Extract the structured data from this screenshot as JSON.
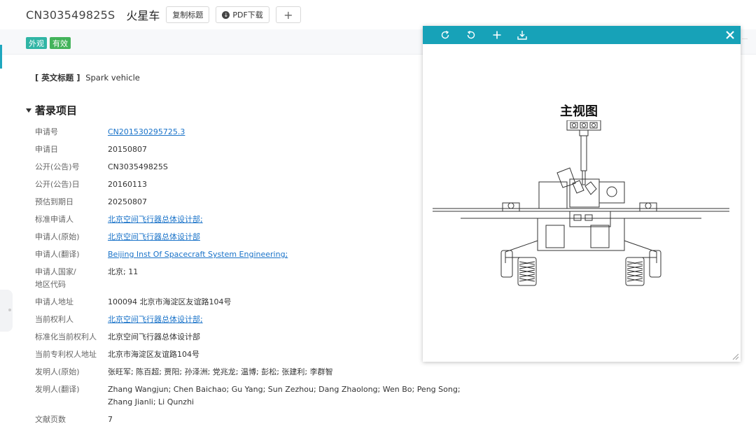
{
  "header": {
    "pub_no": "CN303549825S",
    "title_cn": "火星车",
    "copy_title_label": "复制标题",
    "pdf_label": "PDF下载",
    "plus_label": "+"
  },
  "tags": [
    "外观",
    "有效"
  ],
  "en_title": {
    "label": "[ 英文标题 ]",
    "value": "Spark vehicle"
  },
  "section_title": "著录项目",
  "fields": [
    {
      "k": "申请号",
      "v": "CN201530295725.3",
      "link": true
    },
    {
      "k": "申请日",
      "v": "20150807"
    },
    {
      "k": "公开(公告)号",
      "v": "CN303549825S"
    },
    {
      "k": "公开(公告)日",
      "v": "20160113"
    },
    {
      "k": "预估到期日",
      "v": "20250807"
    },
    {
      "k": "标准申请人",
      "v": "北京空间飞行器总体设计部;",
      "link": true
    },
    {
      "k": "申请人(原始)",
      "v": "北京空间飞行器总体设计部",
      "link": true
    },
    {
      "k": "申请人(翻译)",
      "v": "Beijing Inst Of Spacecraft System Engineering;",
      "link": true
    },
    {
      "k": "申请人国家/\n地区代码",
      "v": "北京; 11"
    },
    {
      "k": "申请人地址",
      "v": "100094 北京市海淀区友谊路104号"
    },
    {
      "k": "当前权利人",
      "v": "北京空间飞行器总体设计部;",
      "link": true
    },
    {
      "k": "标准化当前权利人",
      "v": "北京空间飞行器总体设计部"
    },
    {
      "k": "当前专利权人地址",
      "v": "北京市海淀区友谊路104号"
    },
    {
      "k": "发明人(原始)",
      "v": "张旺军; 陈百超; 贾阳; 孙泽洲; 党兆龙; 温博; 彭松; 张建利; 李群智"
    },
    {
      "k": "发明人(翻译)",
      "v": "Zhang Wangjun; Chen Baichao; Gu Yang; Sun Zezhou; Dang Zhaolong; Wen Bo; Peng Song; Zhang Jianli; Li Qunzhi"
    },
    {
      "k": "文献页数",
      "v": "7"
    }
  ],
  "viewer": {
    "view_label": "主视图",
    "icons": [
      "rotate-cw-icon",
      "rotate-ccw-icon",
      "zoom-in-icon",
      "download-icon",
      "close-icon"
    ]
  },
  "colors": {
    "viewer_bar": "#17a2b8",
    "link": "#1a73c9",
    "tag_blue": "#30b5a5",
    "tag_green": "#43b35a"
  }
}
